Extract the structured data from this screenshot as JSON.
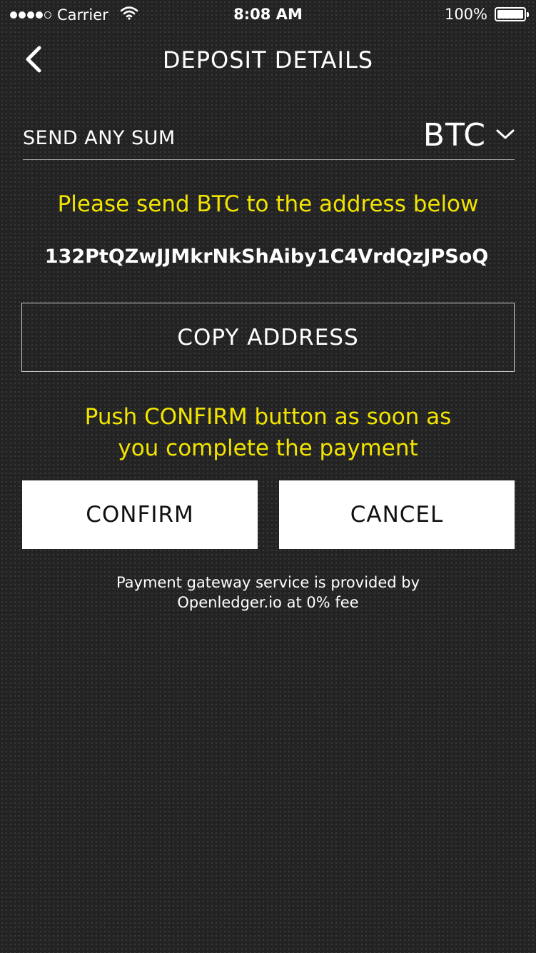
{
  "status_bar": {
    "carrier": "Carrier",
    "time": "8:08 AM",
    "battery": "100%",
    "signal_bars_filled": 4,
    "signal_bars_total": 5
  },
  "nav": {
    "title": "DEPOSIT DETAILS",
    "back_icon": "chevron-left-icon"
  },
  "deposit": {
    "sum_label": "SEND ANY SUM",
    "currency": "BTC",
    "instruction": "Please send BTC to the address below",
    "address": "132PtQZwJJMkrNkShAiby1C4VrdQzJPSoQ",
    "copy_label": "COPY ADDRESS",
    "confirm_note_line1": "Push CONFIRM button as soon as",
    "confirm_note_line2": "you complete the payment"
  },
  "actions": {
    "confirm_label": "CONFIRM",
    "cancel_label": "CANCEL"
  },
  "footer": {
    "line1": "Payment gateway service is provided by",
    "line2": "Openledger.io at 0% fee"
  },
  "colors": {
    "background": "#232323",
    "accent_yellow": "#f2e400",
    "button_fill": "#ffffff",
    "button_text": "#111111"
  }
}
